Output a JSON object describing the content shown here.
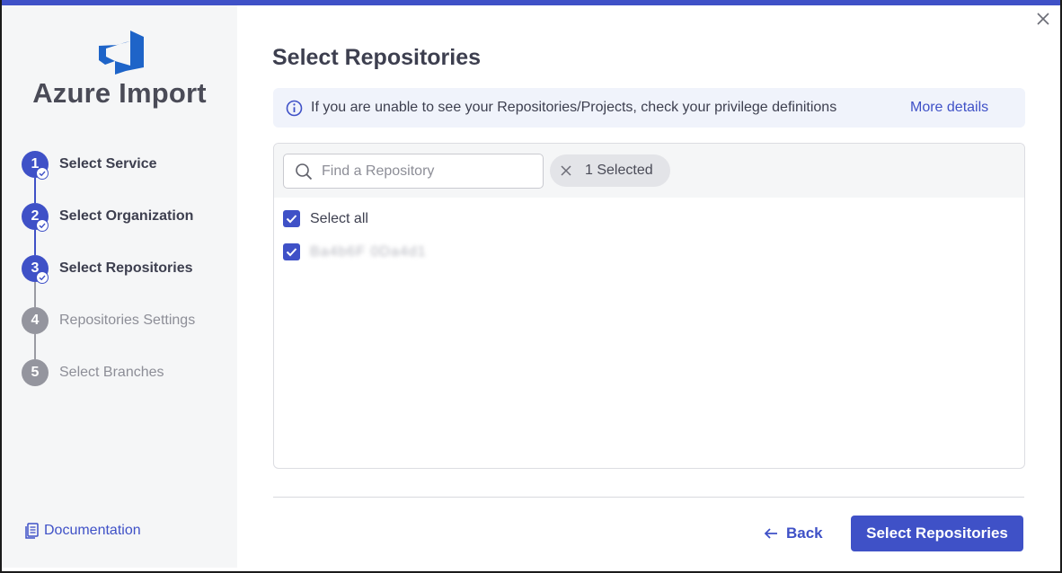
{
  "app": {
    "title": "Azure Import",
    "logo_icon": "azure-devops-logo",
    "accent_color": "#3f51c7"
  },
  "steps": [
    {
      "number": "1",
      "label": "Select Service",
      "status": "done"
    },
    {
      "number": "2",
      "label": "Select Organization",
      "status": "done"
    },
    {
      "number": "3",
      "label": "Select Repositories",
      "status": "done"
    },
    {
      "number": "4",
      "label": "Repositories Settings",
      "status": "todo"
    },
    {
      "number": "5",
      "label": "Select Branches",
      "status": "todo"
    }
  ],
  "sidebar": {
    "documentation_label": "Documentation",
    "documentation_icon": "document-icon"
  },
  "main": {
    "title": "Select Repositories",
    "info": {
      "icon": "info-icon",
      "text": "If you are unable to see your Repositories/Projects, check your privilege definitions",
      "link_label": "More details"
    },
    "search": {
      "placeholder": "Find a Repository",
      "value": ""
    },
    "selected_chip": "1 Selected",
    "select_all_label": "Select all",
    "select_all_checked": true,
    "repositories": [
      {
        "name": "Ba4b6F 0Da4d1",
        "checked": true
      }
    ]
  },
  "footer": {
    "back_label": "Back",
    "primary_label": "Select Repositories"
  }
}
